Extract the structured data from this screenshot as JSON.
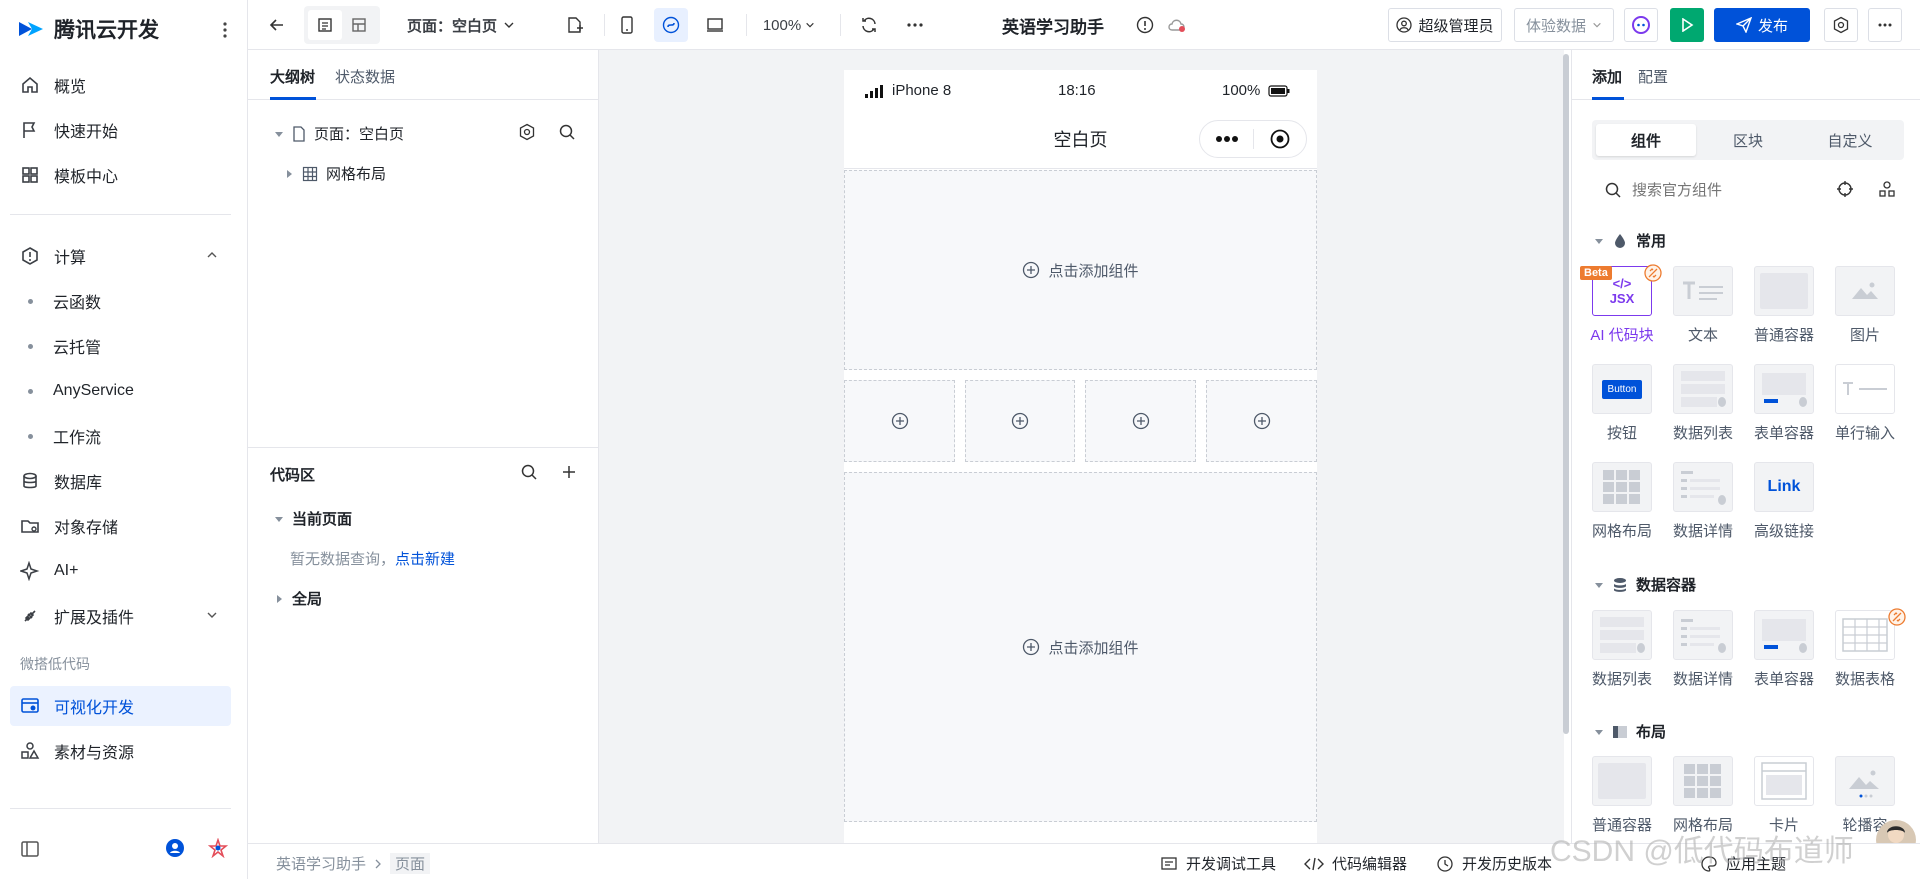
{
  "sidebar": {
    "brand": "腾讯云开发",
    "items": [
      {
        "label": "概览"
      },
      {
        "label": "快速开始"
      },
      {
        "label": "模板中心"
      },
      {
        "label": "计算"
      },
      {
        "label": "云函数"
      },
      {
        "label": "云托管"
      },
      {
        "label": "AnyService"
      },
      {
        "label": "工作流"
      },
      {
        "label": "数据库"
      },
      {
        "label": "对象存储"
      },
      {
        "label": "AI+"
      },
      {
        "label": "扩展及插件"
      },
      {
        "label": "可视化开发"
      },
      {
        "label": "素材与资源"
      }
    ],
    "section_label": "微搭低代码"
  },
  "topbar": {
    "page_selector": "页面：空白页",
    "zoom": "100%",
    "app_title": "英语学习助手",
    "role": "超级管理员",
    "data_env": "体验数据",
    "publish": "发布"
  },
  "leftpanel": {
    "tab_outline": "大纲树",
    "tab_state": "状态数据",
    "tree_page": "页面：空白页",
    "tree_grid": "网格布局",
    "code_title": "代码区",
    "current_page": "当前页面",
    "empty_text": "暂无数据查询，",
    "create_link": "点击新建",
    "global": "全局"
  },
  "phone": {
    "carrier": "iPhone 8",
    "time": "18:16",
    "battery": "100%",
    "title": "空白页",
    "add_component": "点击添加组件"
  },
  "rightpanel": {
    "tab_add": "添加",
    "tab_config": "配置",
    "seg": [
      "组件",
      "区块",
      "自定义"
    ],
    "search_placeholder": "搜索官方组件",
    "groups": [
      {
        "title": "常用",
        "items": [
          "AI 代码块",
          "文本",
          "普通容器",
          "图片",
          "按钮",
          "数据列表",
          "表单容器",
          "单行输入",
          "网格布局",
          "数据详情",
          "高级链接"
        ]
      },
      {
        "title": "数据容器",
        "items": [
          "数据列表",
          "数据详情",
          "表单容器",
          "数据表格"
        ]
      },
      {
        "title": "布局",
        "items": [
          "普通容器",
          "网格布局",
          "卡片",
          "轮播容"
        ]
      }
    ],
    "beta": "Beta",
    "jsx": "JSX",
    "button_thumb": "Button",
    "link_thumb": "Link"
  },
  "bottombar": {
    "crumb_app": "英语学习助手",
    "crumb_page": "页面",
    "dev_tools": "开发调试工具",
    "code_editor": "代码编辑器",
    "history": "开发历史版本",
    "theme": "应用主题"
  },
  "watermark": "CSDN @低代码布道师",
  "colors": {
    "accent": "#0052d9",
    "publish_bg": "#0052d9",
    "run_bg": "#00a870",
    "ai_purple": "#7c3aed",
    "beta_orange": "#ed7b2f"
  }
}
